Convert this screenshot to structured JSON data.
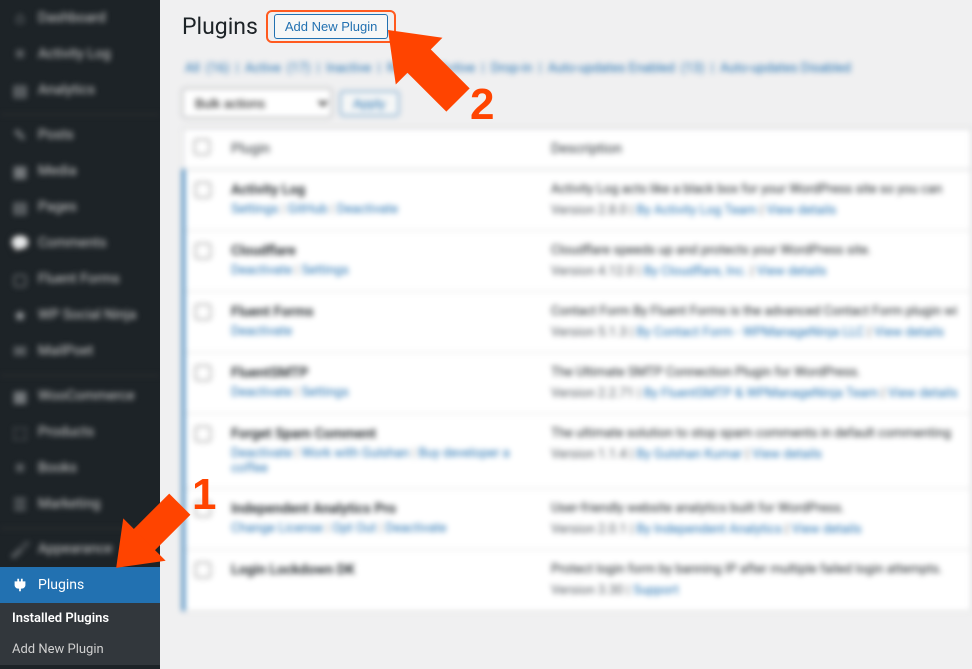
{
  "sidebar": {
    "items": [
      {
        "label": "Dashboard",
        "icon": "⌂"
      },
      {
        "label": "Activity Log",
        "icon": "≡"
      },
      {
        "label": "Analytics",
        "icon": "📊"
      },
      {
        "label": "Posts",
        "icon": "✎"
      },
      {
        "label": "Media",
        "icon": "🖼"
      },
      {
        "label": "Pages",
        "icon": "▤"
      },
      {
        "label": "Comments",
        "icon": "💬"
      },
      {
        "label": "Fluent Forms",
        "icon": "▢"
      },
      {
        "label": "WP Social Ninja",
        "icon": "★"
      },
      {
        "label": "MailPoet",
        "icon": "✉"
      },
      {
        "label": "WooCommerce",
        "icon": "▦"
      },
      {
        "label": "Products",
        "icon": "⬚"
      },
      {
        "label": "Books",
        "icon": "≡"
      },
      {
        "label": "Marketing",
        "icon": "📣"
      },
      {
        "label": "Appearance",
        "icon": "🖌"
      },
      {
        "label": "Plugins",
        "icon": "🔌"
      }
    ],
    "submenu": {
      "installed": "Installed Plugins",
      "add_new": "Add New Plugin"
    }
  },
  "header": {
    "title": "Plugins",
    "add_new_label": "Add New Plugin"
  },
  "filters": {
    "all": "All",
    "all_count": "(16)",
    "active": "Active",
    "active_count": "(17)",
    "inactive": "Inactive",
    "recently_active": "Recently Active",
    "drop_in": "Drop-in",
    "auto_enabled": "Auto-updates Enabled",
    "auto_enabled_count": "(13)",
    "auto_disabled": "Auto-updates Disabled"
  },
  "bulk": {
    "placeholder": "Bulk actions",
    "apply": "Apply"
  },
  "table": {
    "col_plugin": "Plugin",
    "col_desc": "Description",
    "rows": [
      {
        "name": "Activity Log",
        "links": "Settings | GitHub | Deactivate",
        "desc": "Activity Log acts like a black box for your WordPress site so you can",
        "meta": "Version 2.8.0 | By Activity Log Team | View details"
      },
      {
        "name": "Cloudflare",
        "links": "Deactivate | Settings",
        "desc": "Cloudflare speeds up and protects your WordPress site.",
        "meta": "Version 4.12.0 | By Cloudflare, Inc. | View details"
      },
      {
        "name": "Fluent Forms",
        "links": "Deactivate",
        "desc": "Contact Form By Fluent Forms is the advanced Contact Form plugin wi",
        "meta": "Version 5.1.3 | By Contact Form - WPManageNinja LLC | View details"
      },
      {
        "name": "FluentSMTP",
        "links": "Deactivate | Settings",
        "desc": "The Ultimate SMTP Connection Plugin for WordPress.",
        "meta": "Version 2.2.71 | By FluentSMTP & WPManageNinja Team | View details"
      },
      {
        "name": "Forget Spam Comment",
        "links": "Deactivate | Work with Gulshan | Buy developer a coffee",
        "desc": "The ultimate solution to stop spam comments in default commenting",
        "meta": "Version 1.1.4 | By Gulshan Kumar | View details"
      },
      {
        "name": "Independent Analytics Pro",
        "links": "Change License | Opt Out | Deactivate",
        "desc": "User-friendly website analytics built for WordPress.",
        "meta": "Version 2.0.1 | By Independent Analytics | View details"
      },
      {
        "name": "Login Lockdown DK",
        "links": "",
        "desc": "Protect login form by banning IP after multiple failed login attempts.",
        "meta": "Version 3.30 | Support"
      }
    ]
  },
  "annotations": {
    "one": "1",
    "two": "2"
  }
}
